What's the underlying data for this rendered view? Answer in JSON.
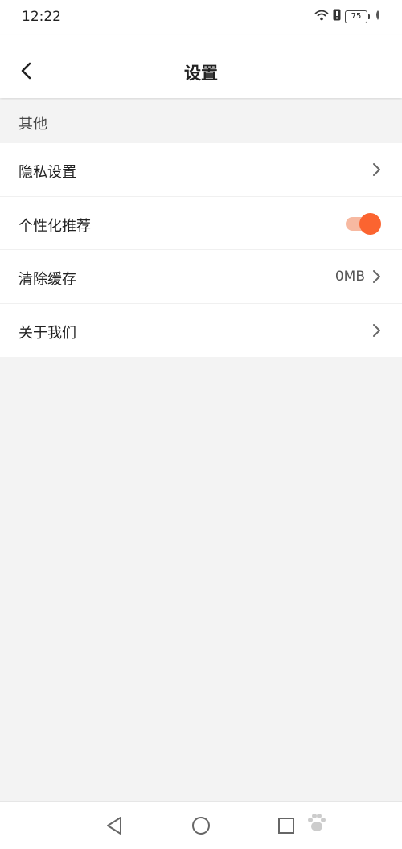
{
  "status_bar": {
    "time": "12:22",
    "battery": "75",
    "icons": [
      "wifi-icon",
      "alert-icon",
      "battery-icon",
      "leaf-icon"
    ]
  },
  "header": {
    "title": "设置",
    "back_icon": "chevron-left-icon"
  },
  "section": {
    "label": "其他"
  },
  "settings": [
    {
      "label": "隐私设置",
      "type": "link"
    },
    {
      "label": "个性化推荐",
      "type": "toggle",
      "enabled": true
    },
    {
      "label": "清除缓存",
      "type": "link",
      "value": "0MB"
    },
    {
      "label": "关于我们",
      "type": "link"
    }
  ],
  "nav_bar": {
    "icons": [
      "back-triangle-icon",
      "home-circle-icon",
      "recents-square-icon"
    ]
  },
  "colors": {
    "accent": "#fb6430",
    "accent_track": "#f7b9a1",
    "background": "#f3f3f3"
  }
}
